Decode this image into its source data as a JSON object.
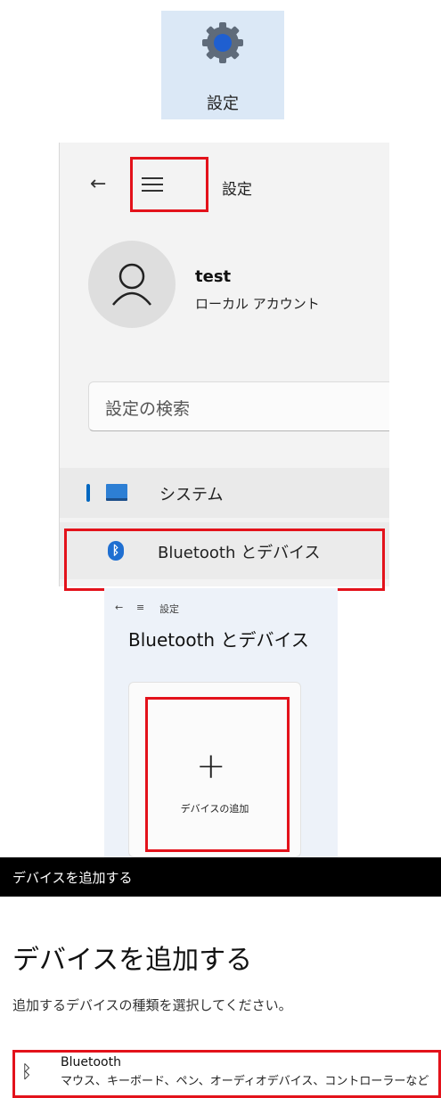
{
  "settings_icon": {
    "label": "設定",
    "icon": "gear-icon"
  },
  "settings_window": {
    "back_icon": "←",
    "menu_icon": "hamburger-menu-icon",
    "title": "設定",
    "user": {
      "name": "test",
      "account_type": "ローカル アカウント"
    },
    "search": {
      "placeholder": "設定の検索"
    },
    "nav": [
      {
        "label": "システム",
        "icon": "system-display-icon",
        "selected": true
      },
      {
        "label": "Bluetooth とデバイス",
        "icon": "bluetooth-icon",
        "highlighted": true
      }
    ]
  },
  "bluetooth_page": {
    "breadcrumb": {
      "back": "←",
      "menu": "≡",
      "title": "設定"
    },
    "heading": "Bluetooth とデバイス",
    "add_device": {
      "plus": "+",
      "label": "デバイスの追加"
    }
  },
  "add_device_dialog": {
    "titlebar": "デバイスを追加する",
    "heading": "デバイスを追加する",
    "description": "追加するデバイスの種類を選択してください。",
    "options": [
      {
        "title": "Bluetooth",
        "subtitle": "マウス、キーボード、ペン、オーディオデバイス、コントローラーなど",
        "icon": "bluetooth-icon"
      }
    ]
  },
  "colors": {
    "highlight": "#e3121b",
    "accent": "#0067c0",
    "icon_tile": "#dbe8f6"
  }
}
